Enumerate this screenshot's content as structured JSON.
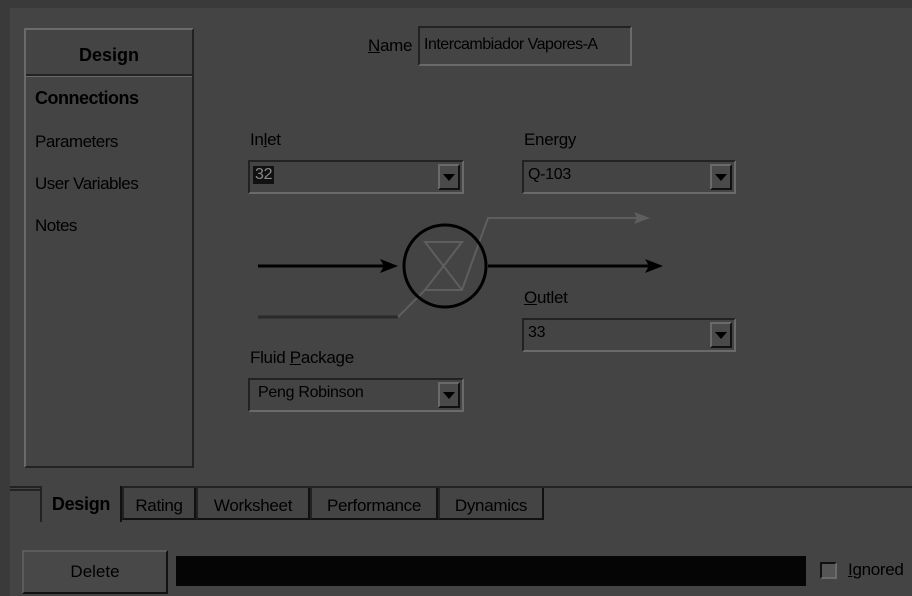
{
  "sidebar": {
    "title": "Design",
    "items": [
      {
        "label": "Connections",
        "active": true
      },
      {
        "label": "Parameters"
      },
      {
        "label": "User Variables"
      },
      {
        "label": "Notes"
      }
    ]
  },
  "name": {
    "label": "Name",
    "value": "Intercambiador Vapores-A"
  },
  "inlet": {
    "label": "Inlet",
    "value": "32"
  },
  "energy": {
    "label": "Energy",
    "value": "Q-103"
  },
  "outlet": {
    "label": "Outlet",
    "value": "33"
  },
  "fluid_package": {
    "label": "Fluid Package",
    "value": "Peng Robinson"
  },
  "tabs": [
    "Design",
    "Rating",
    "Worksheet",
    "Performance",
    "Dynamics"
  ],
  "active_tab": "Design",
  "footer": {
    "delete_label": "Delete",
    "ignored_label": "Ignored",
    "ignored_checked": false
  },
  "icons": {
    "dropdown": "chevron-down-icon",
    "exchanger": "heat-exchanger-icon"
  }
}
